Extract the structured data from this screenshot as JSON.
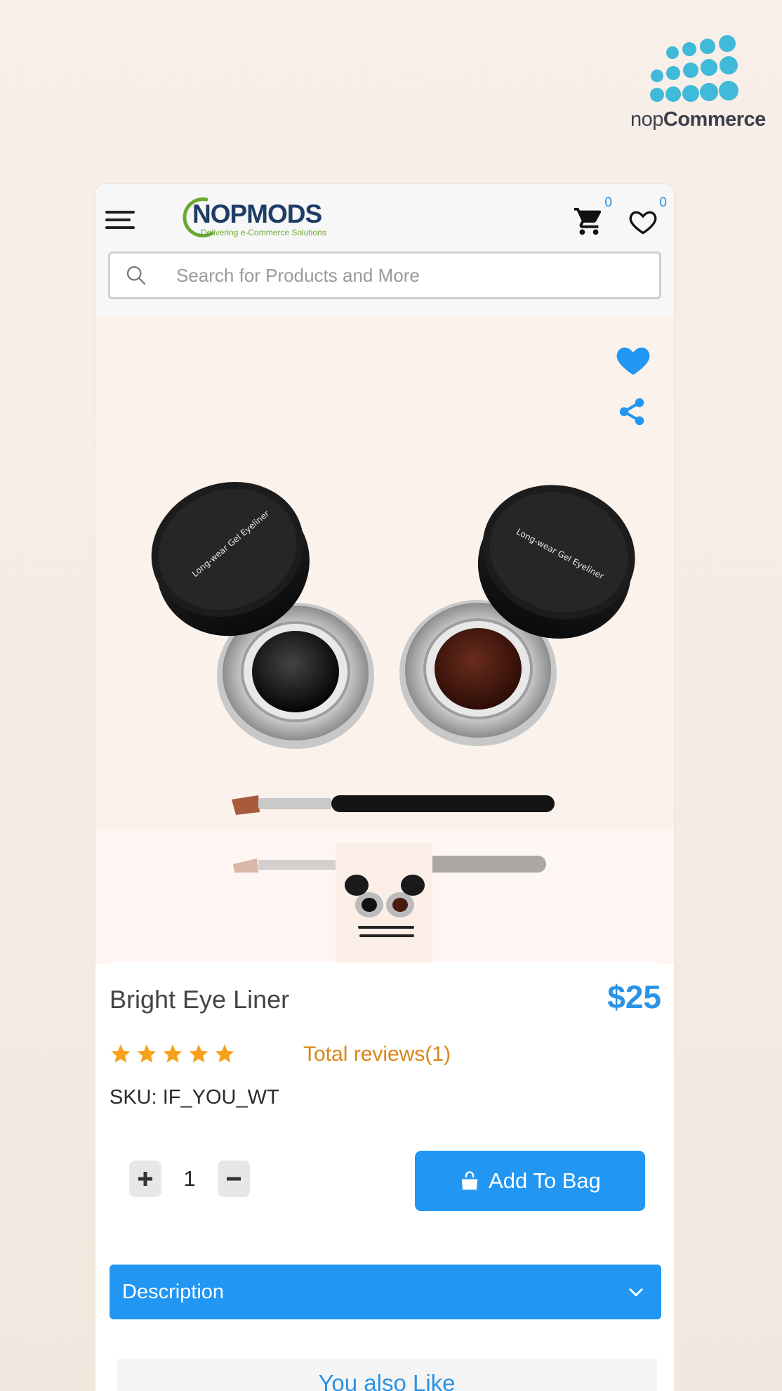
{
  "brand": {
    "name_light": "nop",
    "name_bold": "Commerce",
    "color": "#3fbad8"
  },
  "header": {
    "logo_title": "NOPMODS",
    "logo_subtitle": "Delivering e-Commerce Solutions",
    "cart_count": "0",
    "wishlist_count": "0"
  },
  "search": {
    "placeholder": "Search for Products and More"
  },
  "product": {
    "name": "Bright Eye Liner",
    "price": "$25",
    "rating": 5,
    "reviews_label": "Total reviews(1)",
    "sku": "SKU: IF_YOU_WT",
    "quantity": "1",
    "add_label": "Add To Bag",
    "image_labels": [
      "Long-wear Gel Eyeliner",
      "Long-wear Gel Eyeliner"
    ]
  },
  "accordion": {
    "description_label": "Description"
  },
  "related": {
    "title": "You also Like"
  },
  "colors": {
    "accent": "#2196f3",
    "price": "#2a93e6",
    "reviews": "#d9861a",
    "stars": "#f7a01b"
  }
}
